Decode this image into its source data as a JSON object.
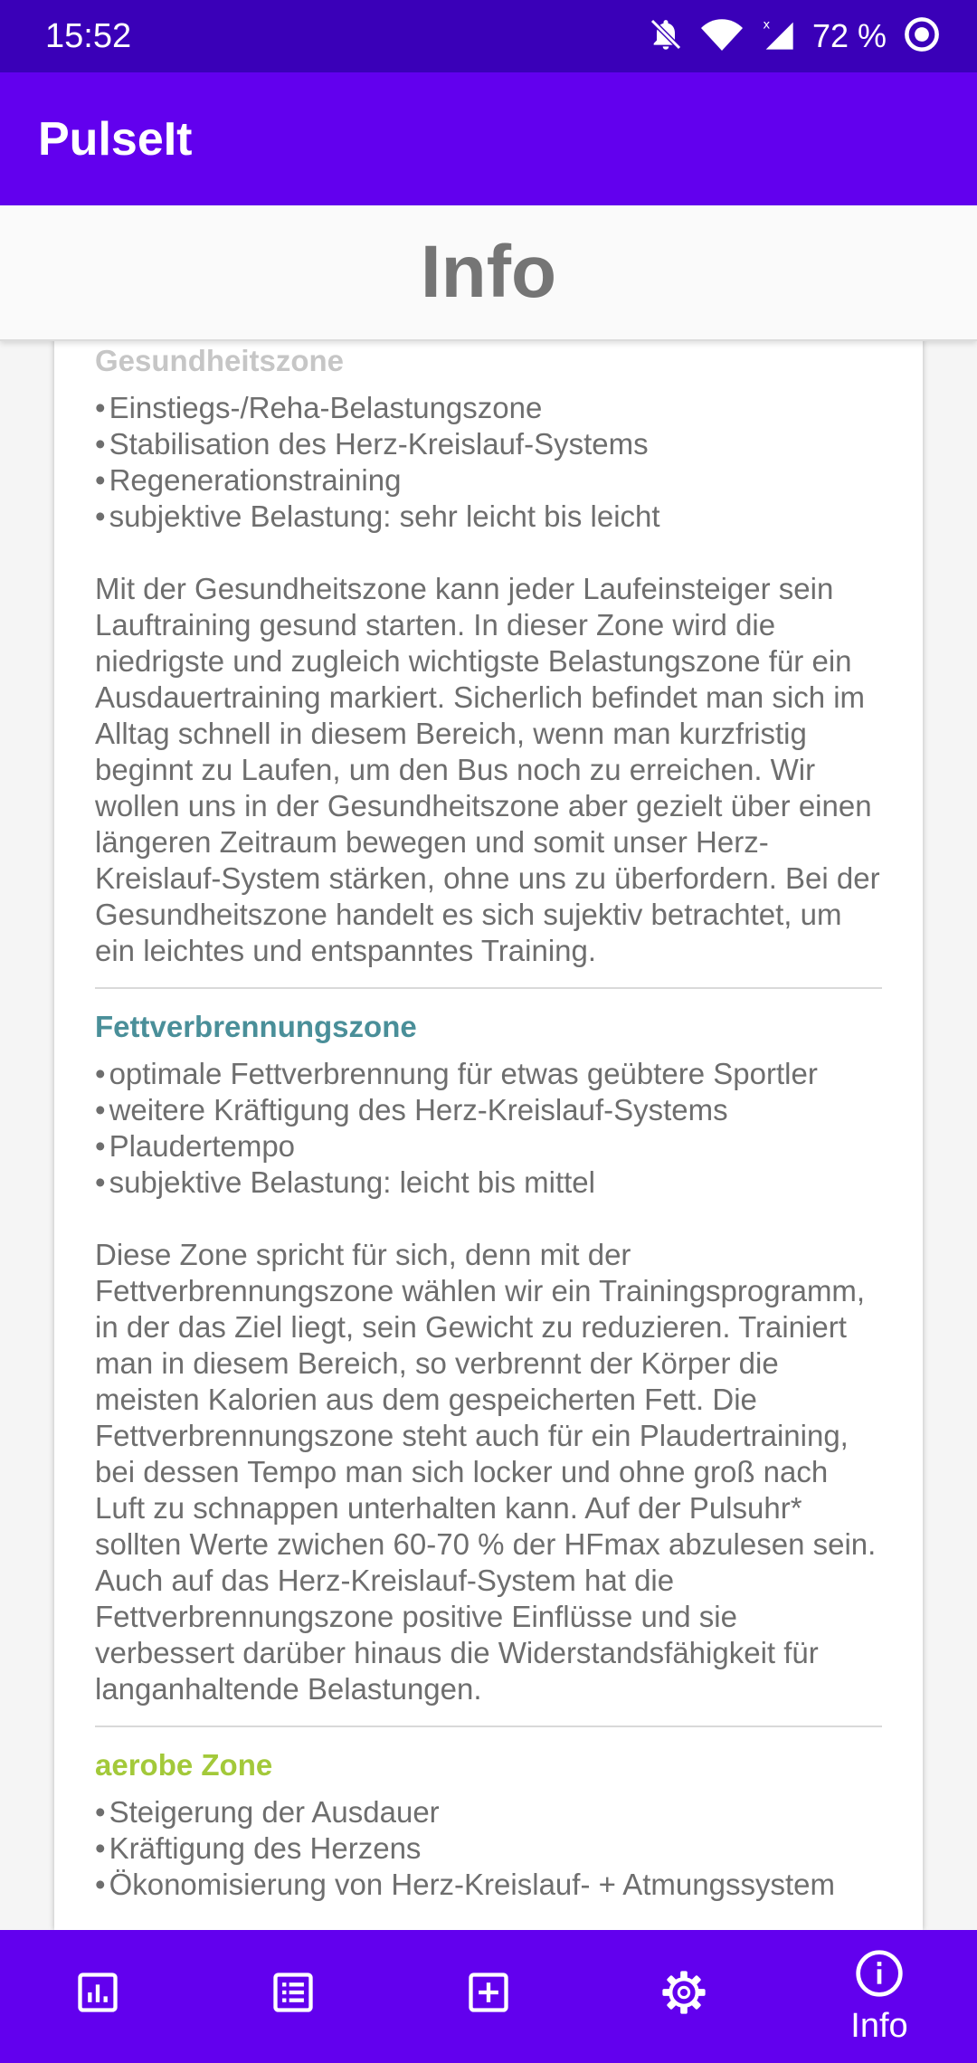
{
  "status_bar": {
    "time": "15:52",
    "battery": "72 %"
  },
  "app": {
    "title": "PulseIt"
  },
  "page": {
    "title": "Info"
  },
  "zones": [
    {
      "title": "Gesundheitszone",
      "color": "#c6c6c6",
      "bullets": [
        "Einstiegs-/Reha-Belastungszone",
        "Stabilisation des Herz-Kreislauf-Systems",
        "Regenerationstraining",
        "subjektive Belastung: sehr leicht bis leicht"
      ],
      "text": "Mit der Gesundheitszone kann jeder Laufeinsteiger sein Lauftraining gesund starten. In dieser Zone wird die niedrigste und zugleich wichtigste Belastungszone für ein Ausdauertraining markiert. Sicherlich befindet man sich im Alltag schnell in diesem Bereich, wenn man kurzfristig beginnt zu Laufen, um den Bus noch zu erreichen. Wir wollen uns in der Gesundheitszone aber gezielt über einen längeren Zeitraum bewegen und somit unser Herz-Kreislauf-System stärken, ohne uns zu überfordern. Bei der Gesundheitszone handelt es sich sujektiv betrachtet, um ein leichtes und entspanntes Training."
    },
    {
      "title": "Fettverbrennungszone",
      "color": "#4a8f99",
      "bullets": [
        "optimale Fettverbrennung für etwas geübtere Sportler",
        "weitere Kräftigung des Herz-Kreislauf-Systems",
        "Plaudertempo",
        "subjektive Belastung: leicht bis mittel"
      ],
      "text": "Diese Zone spricht für sich, denn mit der Fettverbrennungszone wählen wir ein Trainingsprogramm, in der das Ziel liegt, sein Gewicht zu reduzieren. Trainiert man in diesem Bereich, so verbrennt der Körper die meisten Kalorien aus dem gespeicherten Fett. Die Fettverbrennungszone steht auch für ein Plaudertraining, bei dessen Tempo man sich locker und ohne groß nach Luft zu schnappen unterhalten kann. Auf der Pulsuhr* sollten Werte zwichen 60-70 % der HFmax abzulesen sein. Auch auf das Herz-Kreislauf-System hat die Fettverbrennungszone positive Einflüsse und sie verbessert darüber hinaus die Widerstandsfähigkeit für langanhaltende Belastungen."
    },
    {
      "title": "aerobe Zone",
      "color": "#a3c93a",
      "bullets": [
        "Steigerung der Ausdauer",
        "Kräftigung des Herzens",
        "Ökonomisierung von Herz-Kreislauf- + Atmungssystem"
      ],
      "text": ""
    }
  ],
  "bottom_nav": [
    {
      "icon": "chart-icon",
      "label": ""
    },
    {
      "icon": "list-icon",
      "label": ""
    },
    {
      "icon": "add-box-icon",
      "label": ""
    },
    {
      "icon": "settings-icon",
      "label": ""
    },
    {
      "icon": "info-icon",
      "label": "Info"
    }
  ],
  "colors": {
    "app_bar": "#6200ee",
    "status_bar": "#3a00b8",
    "text": "#6e6e6e"
  }
}
